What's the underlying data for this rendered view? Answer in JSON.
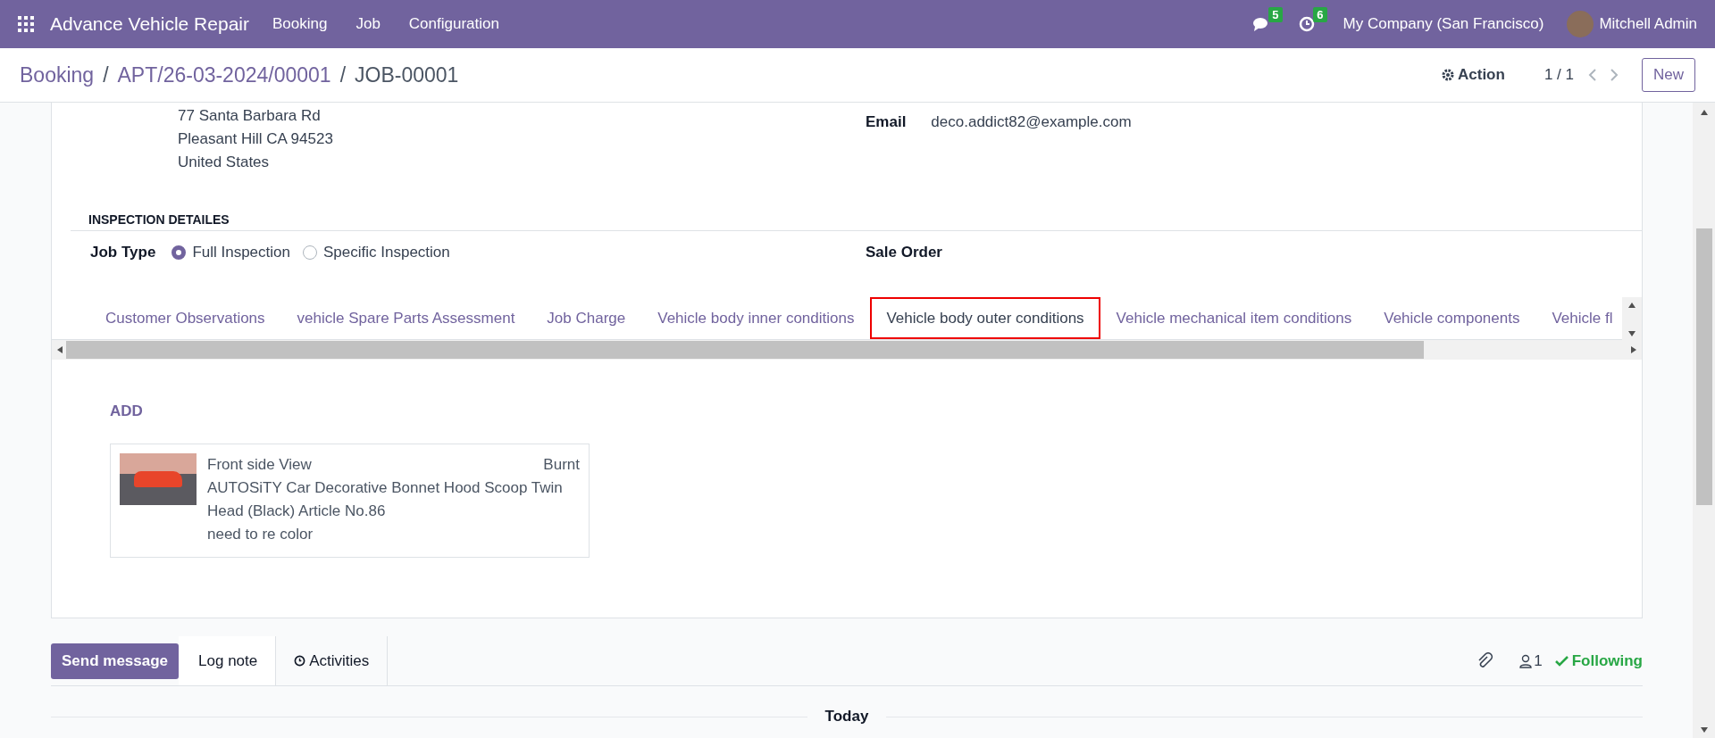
{
  "navbar": {
    "app_name": "Advance Vehicle Repair",
    "menu": [
      "Booking",
      "Job",
      "Configuration"
    ],
    "messages_count": "5",
    "activities_count": "6",
    "company": "My Company (San Francisco)",
    "user": "Mitchell Admin"
  },
  "breadcrumb": [
    "Booking",
    "APT/26-03-2024/00001",
    "JOB-00001"
  ],
  "breadcrumb_separator": "/",
  "control_panel": {
    "action": "Action",
    "pager": "1 / 1",
    "new_button": "New"
  },
  "customer": {
    "address_lines": [
      "77 Santa Barbara Rd",
      "Pleasant Hill CA 94523",
      "United States"
    ],
    "email_label": "Email",
    "email": "deco.addict82@example.com"
  },
  "inspection": {
    "section_title": "INSPECTION DETAILES",
    "job_type_label": "Job Type",
    "job_type_options": [
      {
        "label": "Full Inspection",
        "selected": true
      },
      {
        "label": "Specific Inspection",
        "selected": false
      }
    ],
    "sale_order_label": "Sale Order"
  },
  "tabs": [
    {
      "label": "Customer Observations",
      "selected": false
    },
    {
      "label": "vehicle Spare Parts Assessment",
      "selected": false
    },
    {
      "label": "Job Charge",
      "selected": false
    },
    {
      "label": "Vehicle body inner conditions",
      "selected": false
    },
    {
      "label": "Vehicle body outer conditions",
      "selected": true
    },
    {
      "label": "Vehicle mechanical item conditions",
      "selected": false
    },
    {
      "label": "Vehicle components",
      "selected": false
    },
    {
      "label": "Vehicle fl",
      "selected": false
    }
  ],
  "add_link": "ADD",
  "conditions": [
    {
      "view": "Front side View",
      "status": "Burnt",
      "part": "AUTOSiTY Car Decorative Bonnet Hood Scoop Twin Head (Black) Article No.86",
      "note": "need to re color"
    }
  ],
  "chatter": {
    "send_message": "Send message",
    "log_note": "Log note",
    "activities": "Activities",
    "followers_count": "1",
    "following": "Following",
    "date_separator": "Today"
  }
}
